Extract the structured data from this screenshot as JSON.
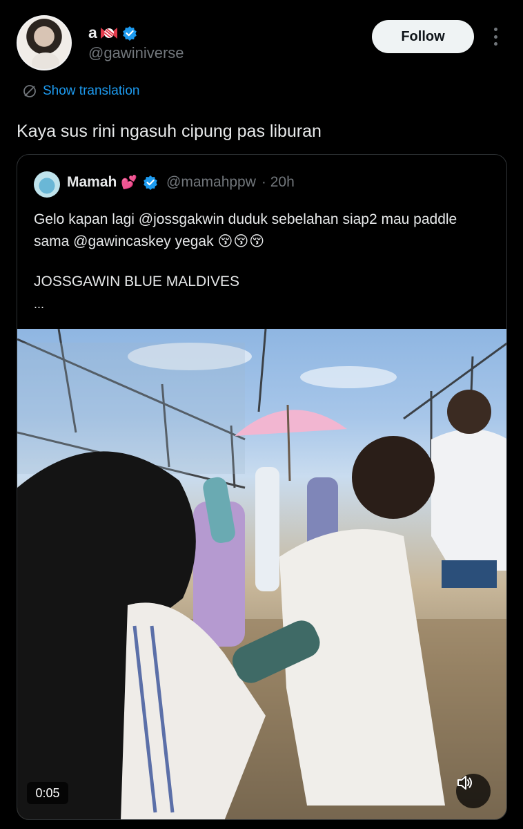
{
  "author": {
    "display_name": "a",
    "display_name_icons": [
      "candy-icon",
      "verified-icon"
    ],
    "handle": "@gawiniverse"
  },
  "actions": {
    "follow_label": "Follow",
    "more_icon": "more-vertical-icon"
  },
  "translation": {
    "label": "Show translation",
    "icon": "translate-icon"
  },
  "tweet": {
    "text": "Kaya sus rini ngasuh cipung pas liburan"
  },
  "quote": {
    "name": "Mamah",
    "name_emoji": "💕",
    "handle": "@mamahppw",
    "time": "· 20h",
    "text": "Gelo kapan lagi @jossgakwin duduk sebelahan siap2 mau paddle sama @gawincaskey yegak",
    "emojis": "😚😚😚",
    "title": "JOSSGAWIN BLUE MALDIVES",
    "ellipsis": "..."
  },
  "video": {
    "duration": "0:05",
    "volume_icon": "volume-icon"
  },
  "colors": {
    "background": "#000000",
    "accent": "#1d9bf0",
    "secondary_text": "#71767b",
    "verified": "#1d9bf0"
  }
}
